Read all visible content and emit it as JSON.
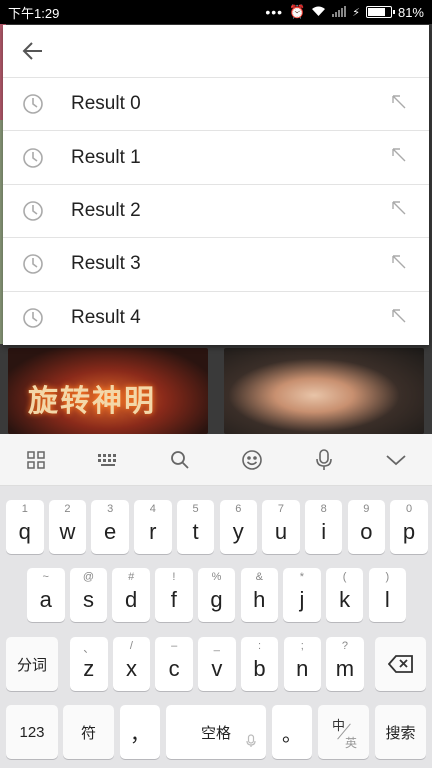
{
  "status_bar": {
    "time": "下午1:29",
    "battery": "81%",
    "battery_level": 0.81
  },
  "search": {
    "results": [
      {
        "label": "Result 0"
      },
      {
        "label": "Result 1"
      },
      {
        "label": "Result 2"
      },
      {
        "label": "Result 3"
      },
      {
        "label": "Result 4"
      }
    ]
  },
  "background": {
    "thumb_left_caption": "旋转神明"
  },
  "keyboard": {
    "row1": [
      {
        "sub": "1",
        "main": "q"
      },
      {
        "sub": "2",
        "main": "w"
      },
      {
        "sub": "3",
        "main": "e"
      },
      {
        "sub": "4",
        "main": "r"
      },
      {
        "sub": "5",
        "main": "t"
      },
      {
        "sub": "6",
        "main": "y"
      },
      {
        "sub": "7",
        "main": "u"
      },
      {
        "sub": "8",
        "main": "i"
      },
      {
        "sub": "9",
        "main": "o"
      },
      {
        "sub": "0",
        "main": "p"
      }
    ],
    "row2": [
      {
        "sub": "~",
        "main": "a"
      },
      {
        "sub": "@",
        "main": "s"
      },
      {
        "sub": "#",
        "main": "d"
      },
      {
        "sub": "!",
        "main": "f"
      },
      {
        "sub": "%",
        "main": "g"
      },
      {
        "sub": "&",
        "main": "h"
      },
      {
        "sub": "*",
        "main": "j"
      },
      {
        "sub": "(",
        "main": "k"
      },
      {
        "sub": ")",
        "main": "l"
      }
    ],
    "row3": [
      {
        "sub": "、",
        "main": "z"
      },
      {
        "sub": "/",
        "main": "x"
      },
      {
        "sub": "–",
        "main": "c"
      },
      {
        "sub": "_",
        "main": "v"
      },
      {
        "sub": ":",
        "main": "b"
      },
      {
        "sub": ";",
        "main": "n"
      },
      {
        "sub": "?",
        "main": "m"
      }
    ],
    "fenci": "分词",
    "num_key": "123",
    "symbol_key": "符",
    "comma_key": "，",
    "space_key": "空格",
    "period_key": "。",
    "lang_top": "中",
    "lang_bottom": "英",
    "search_key": "搜索"
  }
}
